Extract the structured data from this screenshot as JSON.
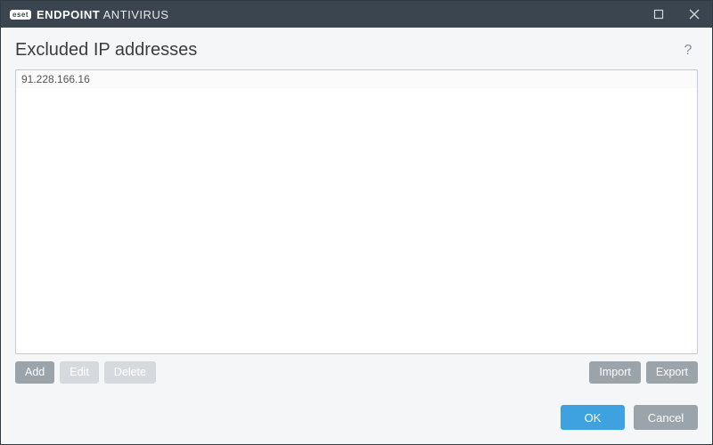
{
  "titlebar": {
    "brand_badge": "eset",
    "brand_strong": "ENDPOINT",
    "brand_light": "ANTIVIRUS"
  },
  "header": {
    "title": "Excluded IP addresses",
    "help": "?"
  },
  "list": {
    "items": [
      "91.228.166.16"
    ]
  },
  "actions": {
    "add": "Add",
    "edit": "Edit",
    "delete": "Delete",
    "import": "Import",
    "export": "Export"
  },
  "footer": {
    "ok": "OK",
    "cancel": "Cancel"
  }
}
